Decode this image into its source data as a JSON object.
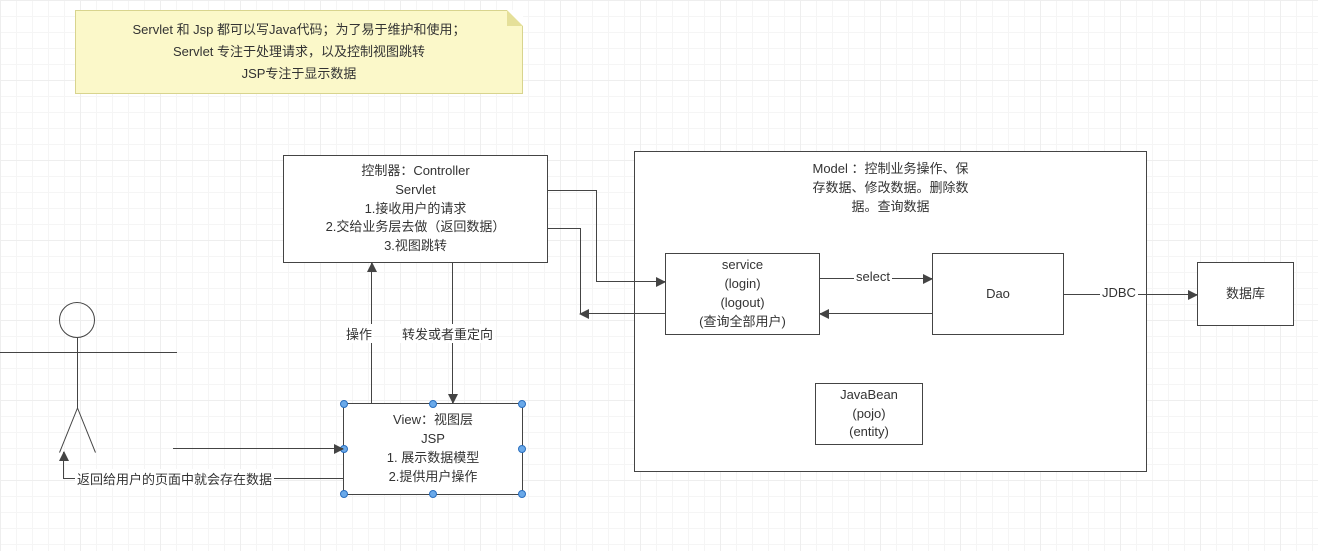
{
  "note": {
    "line1": "Servlet 和 Jsp  都可以写Java代码；为了易于维护和使用；",
    "line2": "Servlet 专注于处理请求，以及控制视图跳转",
    "line3": "JSP专注于显示数据"
  },
  "controller": {
    "title": "控制器：Controller",
    "sub": "Servlet",
    "l1": "1.接收用户的请求",
    "l2": "2.交给业务层去做（返回数据）",
    "l3": "3.视图跳转"
  },
  "view": {
    "title": "View：视图层",
    "sub": "JSP",
    "l1": "1. 展示数据模型",
    "l2": "2.提供用户操作"
  },
  "model": {
    "title": "Model ：控制业务操作、保",
    "l2": "存数据、修改数据。删除数",
    "l3": "据。查询数据"
  },
  "service": {
    "l1": "service",
    "l2": "(login)",
    "l3": "(logout)",
    "l4": "(查询全部用户)"
  },
  "dao": {
    "label": "Dao"
  },
  "database": {
    "label": "数据库"
  },
  "javabean": {
    "l1": "JavaBean",
    "l2": "(pojo)",
    "l3": "(entity)"
  },
  "labels": {
    "operate": "操作",
    "forward": "转发或者重定向",
    "select": "select",
    "jdbc": "JDBC",
    "return": "返回给用户的页面中就会存在数据"
  }
}
